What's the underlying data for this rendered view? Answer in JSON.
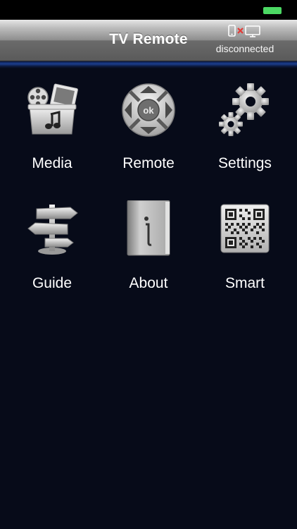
{
  "header": {
    "title": "TV Remote",
    "connection_status": "disconnected"
  },
  "colors": {
    "background": "#070b19",
    "battery": "#4cd964",
    "accent_line": "#1c3f8f",
    "disconnect_mark": "#e53935"
  },
  "menu": {
    "items": [
      {
        "label": "Media",
        "icon": "media-icon"
      },
      {
        "label": "Remote",
        "icon": "remote-dpad-icon"
      },
      {
        "label": "Settings",
        "icon": "gears-icon"
      },
      {
        "label": "Guide",
        "icon": "signpost-icon"
      },
      {
        "label": "About",
        "icon": "info-book-icon"
      },
      {
        "label": "Smart",
        "icon": "qr-code-icon"
      }
    ],
    "remote_ok_label": "ok"
  }
}
